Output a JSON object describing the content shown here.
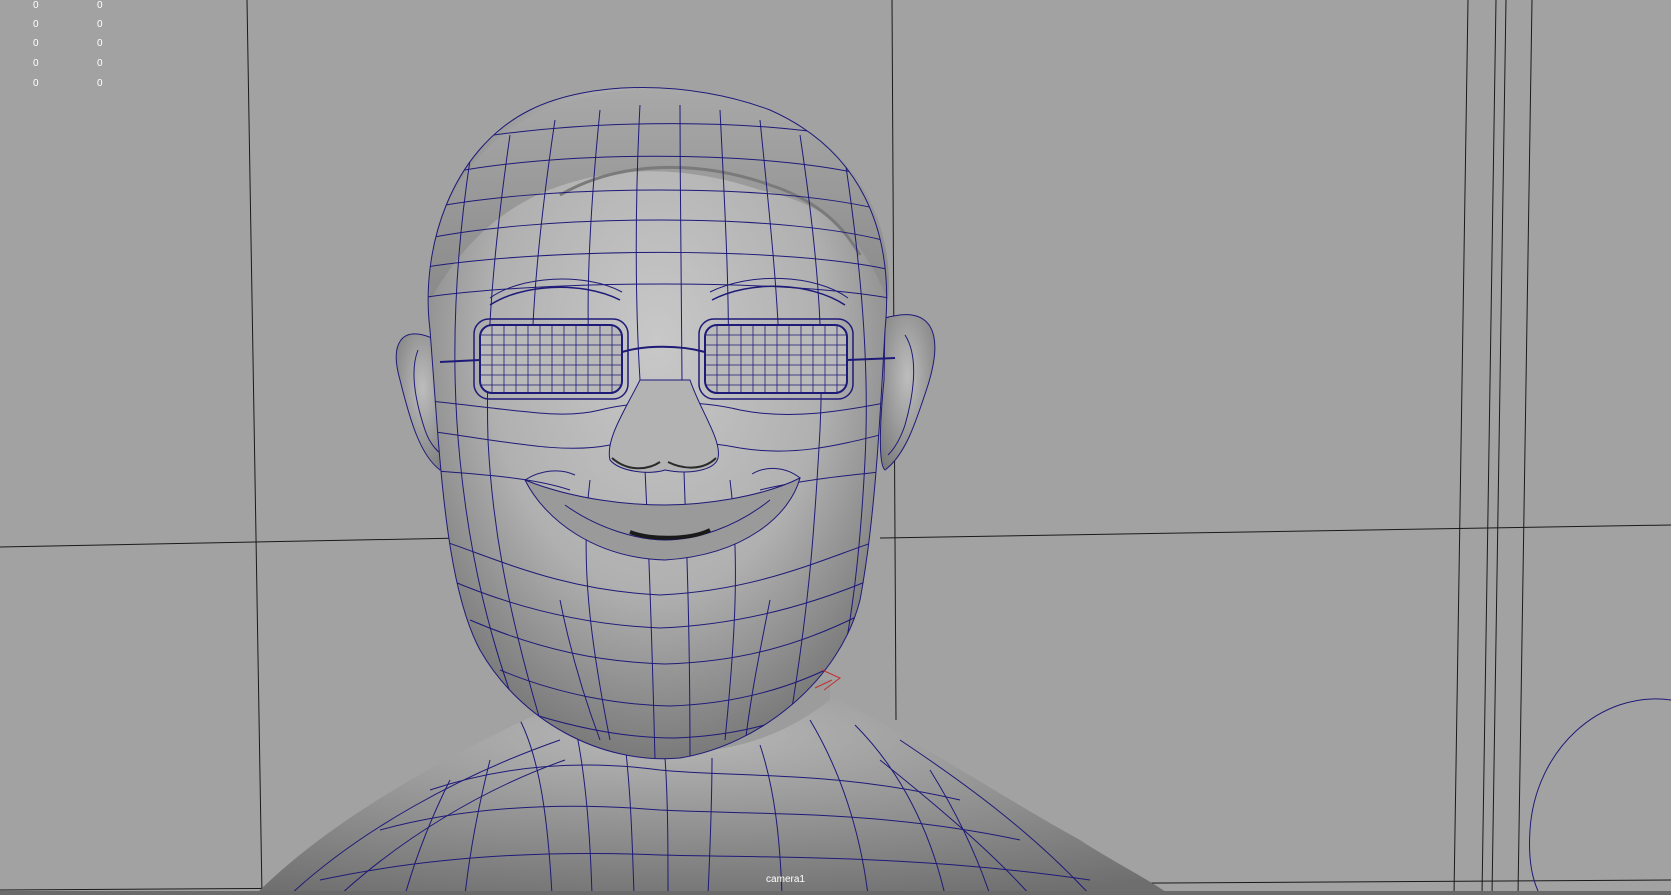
{
  "viewport": {
    "camera_label": "camera1",
    "hud_rows": [
      {
        "a": "0",
        "b": "0"
      },
      {
        "a": "0",
        "b": "0"
      },
      {
        "a": "0",
        "b": "0"
      },
      {
        "a": "0",
        "b": "0"
      },
      {
        "a": "0",
        "b": "0"
      }
    ]
  },
  "colors": {
    "background": "#a2a2a2",
    "wireframe": "#1e1a78",
    "surface_light": "#c4c4c4",
    "surface_dark": "#707070",
    "grid_line": "#1a1a1a",
    "text": "#ffffff"
  }
}
